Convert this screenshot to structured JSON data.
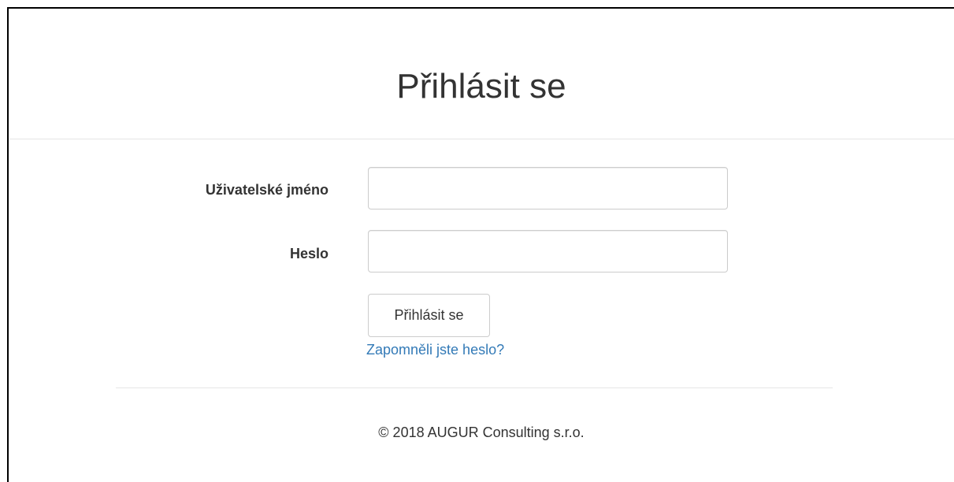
{
  "header": {
    "title": "Přihlásit se"
  },
  "form": {
    "username_label": "Uživatelské jméno",
    "username_value": "",
    "password_label": "Heslo",
    "password_value": "",
    "submit_label": "Přihlásit se",
    "forgot_password_label": "Zapomněli jste heslo?"
  },
  "footer": {
    "copyright": "© 2018 AUGUR Consulting s.r.o."
  },
  "colors": {
    "link": "#337ab7",
    "text": "#333333",
    "input_border": "#cccccc",
    "divider": "#e5e5e5"
  }
}
